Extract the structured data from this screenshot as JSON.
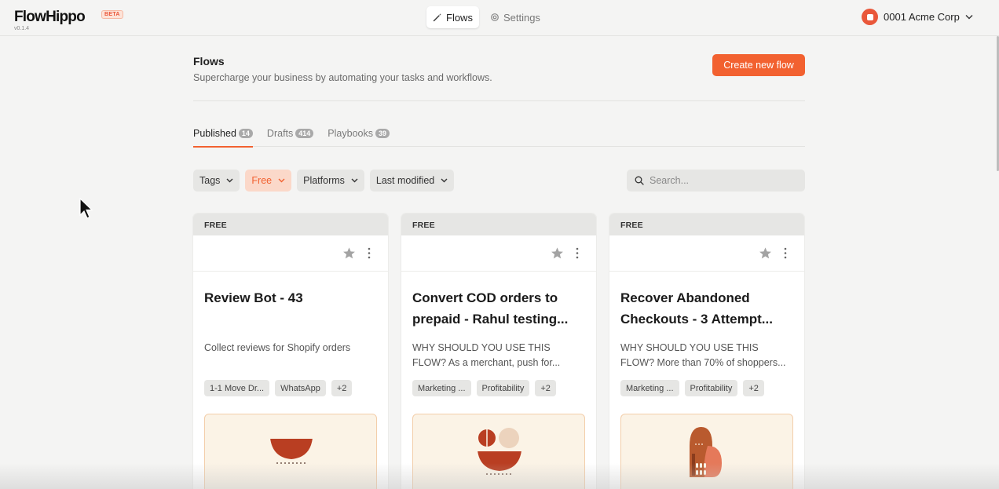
{
  "app": {
    "logo_text": "FlowHippo",
    "beta_badge": "BETA",
    "version": "v0.1.4"
  },
  "nav": {
    "tabs": [
      {
        "label": "Flows",
        "icon": "wand-icon",
        "active": true
      },
      {
        "label": "Settings",
        "icon": "gear-icon",
        "active": false
      }
    ]
  },
  "account": {
    "name": "0001 Acme Corp"
  },
  "page": {
    "title": "Flows",
    "subtitle": "Supercharge your business by automating your tasks and workflows.",
    "create_button": "Create new flow"
  },
  "tabs": [
    {
      "label": "Published",
      "count": "14",
      "active": true
    },
    {
      "label": "Drafts",
      "count": "414",
      "active": false
    },
    {
      "label": "Playbooks",
      "count": "39",
      "active": false
    }
  ],
  "filters": [
    {
      "label": "Tags",
      "selected": false
    },
    {
      "label": "Free",
      "selected": true
    },
    {
      "label": "Platforms",
      "selected": false
    },
    {
      "label": "Last modified",
      "selected": false
    }
  ],
  "search": {
    "placeholder": "Search..."
  },
  "cards": [
    {
      "badge": "FREE",
      "title": "Review Bot - 43",
      "description": "Collect reviews for Shopify orders",
      "tags": [
        "1-1 Move Dr...",
        "WhatsApp",
        "+2"
      ]
    },
    {
      "badge": "FREE",
      "title": "Convert COD orders to prepaid - Rahul testing...",
      "description": "WHY SHOULD YOU USE THIS FLOW? As a merchant, push for...",
      "tags": [
        "Marketing ...",
        "Profitability",
        "+2"
      ]
    },
    {
      "badge": "FREE",
      "title": "Recover Abandoned Checkouts - 3 Attempt...",
      "description": "WHY SHOULD YOU USE THIS FLOW? More than 70% of shoppers...",
      "tags": [
        "Marketing ...",
        "Profitability",
        "+2"
      ]
    }
  ],
  "colors": {
    "accent": "#f26130",
    "background": "#f4f4f3",
    "art_background": "#fbf3e6"
  }
}
